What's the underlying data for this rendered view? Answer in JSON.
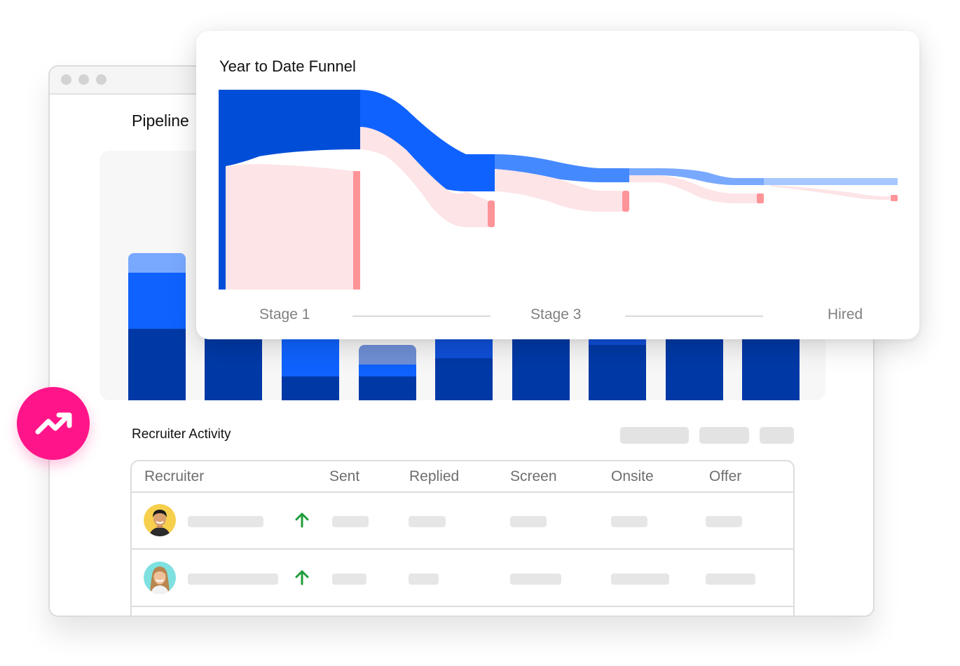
{
  "pipeline": {
    "title": "Pipeline",
    "colors": {
      "dark": "#0039a6",
      "mid": "#0f62fe",
      "light": "#78a9ff",
      "pale": "#6f8fd6"
    }
  },
  "funnel_card": {
    "title": "Year to Date Funnel",
    "stages": [
      "Stage 1",
      "Stage 3",
      "Hired"
    ],
    "colors": {
      "primary": "#004ed8",
      "primary_bright": "#0f62fe",
      "mid": "#4589ff",
      "light": "#a6c8ff",
      "dropoff": "#fde4e7",
      "dropoff_edge": "#ff9498"
    }
  },
  "recruiter_activity": {
    "title": "Recruiter Activity",
    "columns": [
      "Recruiter",
      "Sent",
      "Replied",
      "Screen",
      "Onsite",
      "Offer"
    ],
    "rows": [
      {
        "avatar": "avatar-man-yellow-bg",
        "trend": "up-arrow-icon"
      },
      {
        "avatar": "avatar-woman-teal-bg",
        "trend": "up-arrow-icon"
      }
    ]
  },
  "badge": {
    "icon": "trending-up-icon",
    "color": "#ff1589"
  }
}
